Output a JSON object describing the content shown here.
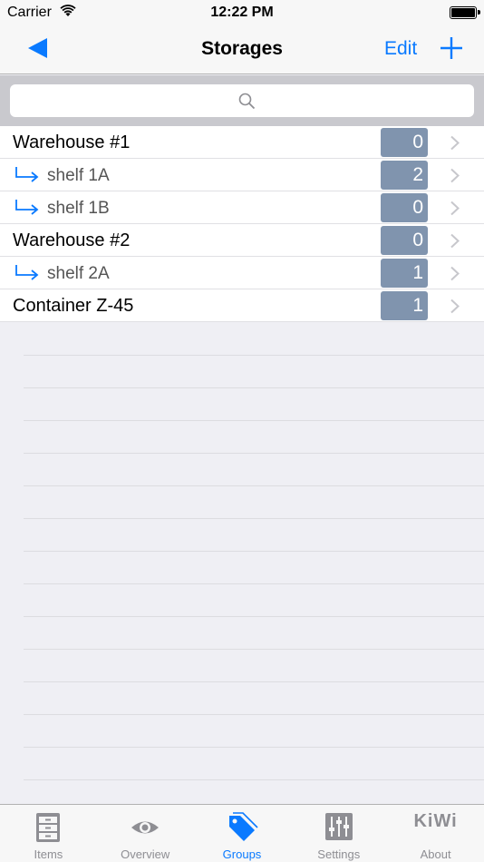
{
  "status_bar": {
    "carrier": "Carrier",
    "time": "12:22 PM"
  },
  "nav": {
    "title": "Storages",
    "edit_label": "Edit"
  },
  "search": {
    "placeholder": ""
  },
  "storages": [
    {
      "name": "Warehouse #1",
      "count": "0",
      "level": "top"
    },
    {
      "name": "shelf 1A",
      "count": "2",
      "level": "child"
    },
    {
      "name": "shelf 1B",
      "count": "0",
      "level": "child"
    },
    {
      "name": "Warehouse #2",
      "count": "0",
      "level": "top"
    },
    {
      "name": "shelf 2A",
      "count": "1",
      "level": "child"
    },
    {
      "name": "Container Z-45",
      "count": "1",
      "level": "top"
    }
  ],
  "tabs": [
    {
      "label": "Items",
      "icon": "cabinet-icon"
    },
    {
      "label": "Overview",
      "icon": "eye-icon"
    },
    {
      "label": "Groups",
      "icon": "tag-icon",
      "active": true
    },
    {
      "label": "Settings",
      "icon": "sliders-icon"
    },
    {
      "label": "About",
      "icon": "kiwi-logo",
      "logo_text": "KiWi"
    }
  ],
  "colors": {
    "accent": "#0a7aff",
    "badge": "#8094ae",
    "tab_inactive": "#8e8e93"
  }
}
